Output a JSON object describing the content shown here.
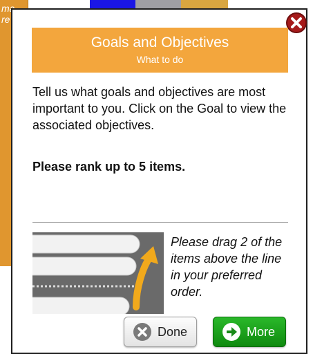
{
  "background": {
    "left_text": "ma\nre"
  },
  "dialog": {
    "header": {
      "title": "Goals and Objectives",
      "subtitle": "What to do"
    },
    "intro": "Tell us what goals and objectives are most important to you. Click on the Goal to view the associated objectives.",
    "rank_instruction": "Please rank up to 5 items.",
    "drag_instruction": "Please drag 2 of the items above the line in your preferred order.",
    "buttons": {
      "done_label": "Done",
      "more_label": "More"
    }
  },
  "colors": {
    "header_bg": "#f3a63d",
    "close_red": "#a61a1a",
    "more_green": "#1aa01a",
    "bg_orange": "#e0962f"
  },
  "icons": {
    "close": "close-icon",
    "done": "x-circle-icon",
    "more": "arrow-right-circle-icon",
    "drag": "drag-reorder-illustration"
  }
}
